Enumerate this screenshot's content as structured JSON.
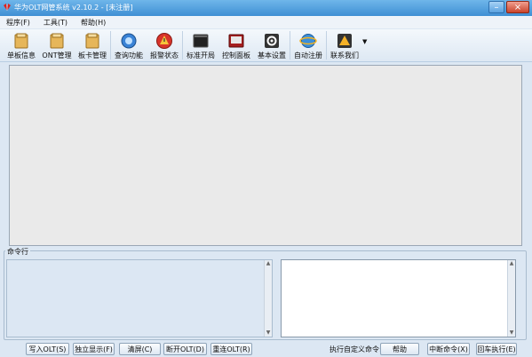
{
  "window": {
    "title": "华为OLT网管系统 v2.10.2 - [未注册]",
    "minimize": "–",
    "close": "×"
  },
  "menu": [
    "程序(F)",
    "工具(T)",
    "帮助(H)"
  ],
  "toolbar": [
    {
      "label": "单板信息",
      "icon": "folder-icon"
    },
    {
      "label": "ONT管理",
      "icon": "folder-icon"
    },
    {
      "label": "板卡管理",
      "icon": "folder-icon"
    },
    {
      "label": "查询功能",
      "icon": "search-globe-icon"
    },
    {
      "label": "报警状态",
      "icon": "alarm-icon"
    },
    {
      "label": "标准开局",
      "icon": "terminal-icon"
    },
    {
      "label": "控制面板",
      "icon": "control-panel-icon"
    },
    {
      "label": "基本设置",
      "icon": "gear-icon"
    },
    {
      "label": "自动注册",
      "icon": "ie-globe-icon"
    },
    {
      "label": "联系我们",
      "icon": "contact-icon"
    }
  ],
  "command_panel": {
    "legend": "命令行"
  },
  "bottom": {
    "write_olt": "写入OLT(S)",
    "standalone_display": "独立显示(F)",
    "clear_screen": "清屏(C)",
    "disconnect_olt": "断开OLT(D)",
    "reconnect_olt": "重连OLT(R)",
    "custom_label": "执行自定义命令:",
    "help": "帮助",
    "interrupt": "中断命令(X)",
    "enter_execute": "回车执行(E)"
  },
  "colors": {
    "title_bar": "#3f8fd4",
    "background": "#dce7f3",
    "main_panel": "#eaeaea"
  }
}
